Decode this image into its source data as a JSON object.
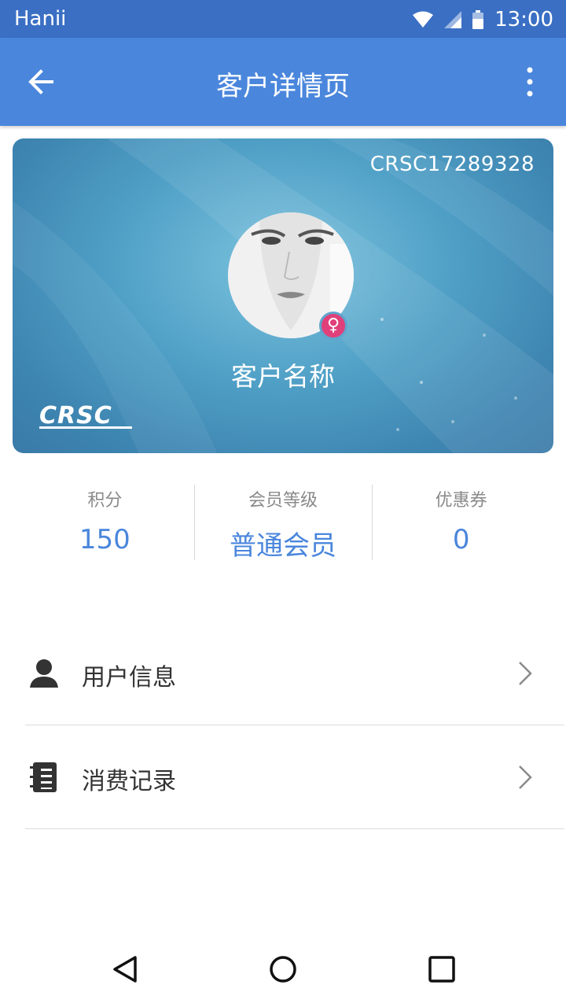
{
  "status_bar": {
    "carrier": "Hanii",
    "time": "13:00",
    "icons": [
      "wifi-icon",
      "signal-icon",
      "battery-icon"
    ]
  },
  "app_bar": {
    "title": "客户详情页",
    "back_icon": "arrow-left-icon",
    "more_icon": "more-vert-icon"
  },
  "card": {
    "card_number": "CRSC17289328",
    "customer_name": "客户名称",
    "gender_symbol": "♀",
    "logo_text": "CRSC"
  },
  "stats": [
    {
      "label": "积分",
      "value": "150"
    },
    {
      "label": "会员等级",
      "value": "普通会员"
    },
    {
      "label": "优惠券",
      "value": "0"
    }
  ],
  "menu": [
    {
      "label": "用户信息",
      "icon": "user-icon"
    },
    {
      "label": "消费记录",
      "icon": "receipt-icon"
    }
  ],
  "nav_bar": {
    "icons": [
      "back-triangle-icon",
      "home-circle-icon",
      "recents-square-icon"
    ]
  },
  "colors": {
    "status_bar": "#3a6fc4",
    "app_bar": "#4a86dc",
    "accent": "#4a86dc",
    "gender_badge": "#e0407a"
  }
}
